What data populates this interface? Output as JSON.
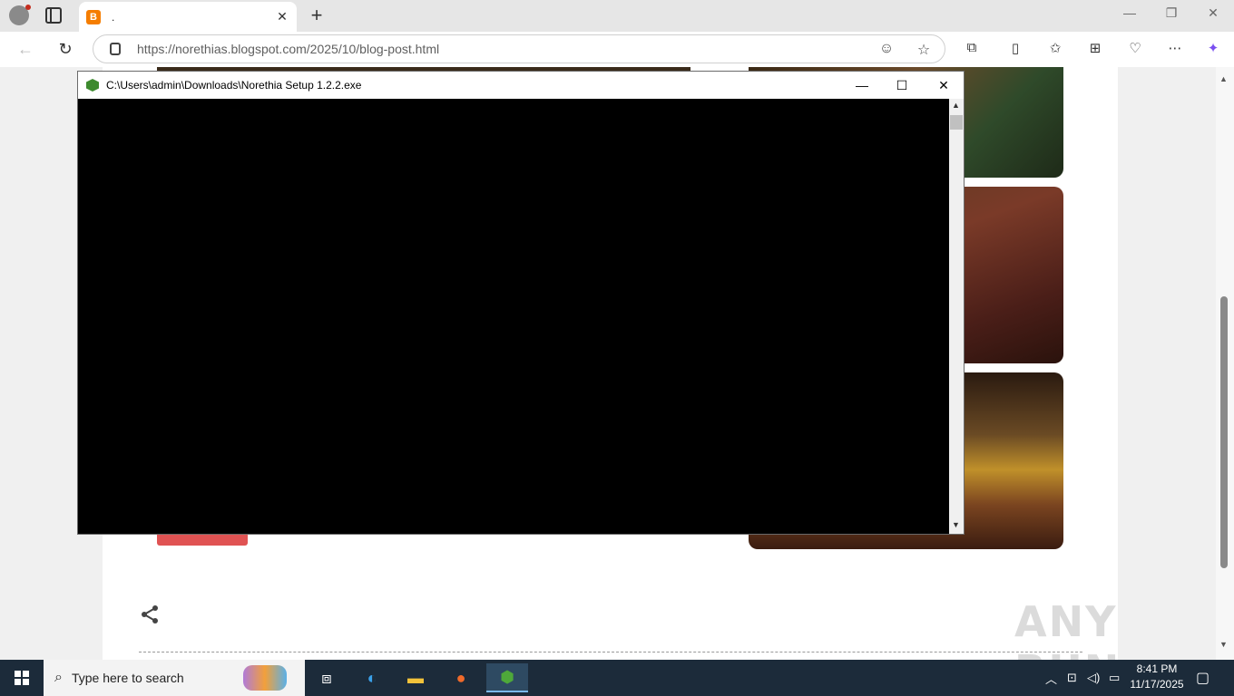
{
  "browser": {
    "tab_title": ".",
    "url_host": "https://norethias.blogspot.com",
    "url_path": "/2025/10/blog-post.html"
  },
  "console_window": {
    "title": "C:\\Users\\admin\\Downloads\\Norethia Setup 1.2.2.exe"
  },
  "taskbar": {
    "search_placeholder": "Type here to search",
    "time": "8:41 PM",
    "date": "11/17/2025"
  },
  "watermark": "ANY RUN",
  "icons": [
    "profile-icon",
    "tab-actions-icon",
    "blogger-favicon",
    "close-tab-icon",
    "new-tab-icon",
    "minimize-icon",
    "restore-icon",
    "close-window-icon",
    "back-icon",
    "refresh-icon",
    "lock-icon",
    "read-aloud-icon",
    "favorite-star-icon",
    "extensions-icon",
    "split-screen-icon",
    "favorites-icon",
    "collections-icon",
    "browser-essentials-icon",
    "more-icon",
    "copilot-icon",
    "share-icon",
    "windows-start-icon",
    "search-icon",
    "task-view-icon",
    "edge-icon",
    "file-explorer-icon",
    "firefox-icon",
    "norethia-app-icon",
    "tray-chevron-icon",
    "network-icon",
    "volume-icon",
    "notification-icon"
  ]
}
